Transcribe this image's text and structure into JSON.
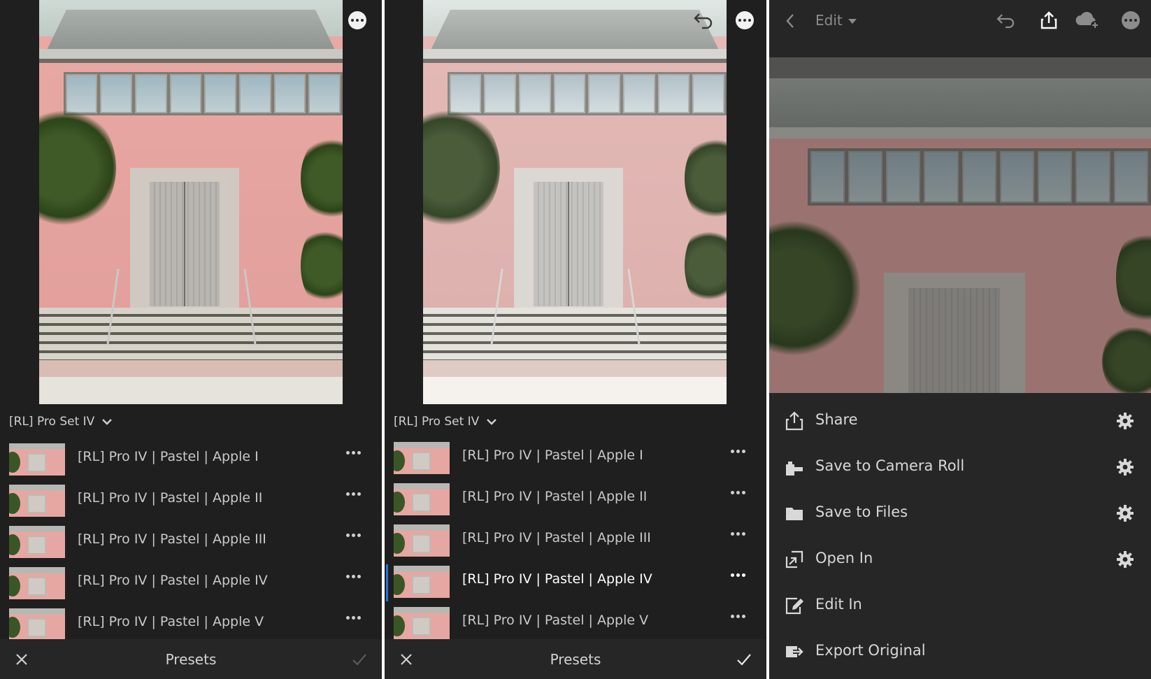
{
  "panels": [
    {
      "set_name": "[RL] Pro Set IV",
      "presets": [
        "[RL] Pro IV | Pastel | Apple I",
        "[RL] Pro IV | Pastel | Apple II",
        "[RL] Pro IV | Pastel | Apple III",
        "[RL] Pro IV | Pastel | Apple IV",
        "[RL] Pro IV | Pastel | Apple V"
      ],
      "active_index": -1,
      "bottom_title": "Presets"
    },
    {
      "set_name": "[RL] Pro Set IV",
      "presets": [
        "[RL] Pro IV | Pastel | Apple I",
        "[RL] Pro IV | Pastel | Apple II",
        "[RL] Pro IV | Pastel | Apple III",
        "[RL] Pro IV | Pastel | Apple IV",
        "[RL] Pro IV | Pastel | Apple V"
      ],
      "active_index": 3,
      "bottom_title": "Presets"
    }
  ],
  "export_panel": {
    "edit_label": "Edit",
    "menu": [
      {
        "label": "Share",
        "icon": "share-icon",
        "gear": true
      },
      {
        "label": "Save to Camera Roll",
        "icon": "camera-roll-icon",
        "gear": true
      },
      {
        "label": "Save to Files",
        "icon": "folder-icon",
        "gear": true
      },
      {
        "label": "Open In",
        "icon": "open-in-icon",
        "gear": true
      },
      {
        "label": "Edit In",
        "icon": "edit-in-icon",
        "gear": false
      },
      {
        "label": "Export Original",
        "icon": "export-original-icon",
        "gear": false
      }
    ]
  },
  "colors": {
    "background": "#1f1f1f",
    "bar": "#262626",
    "accent": "#2b74d8",
    "text": "#c9c9c9"
  }
}
